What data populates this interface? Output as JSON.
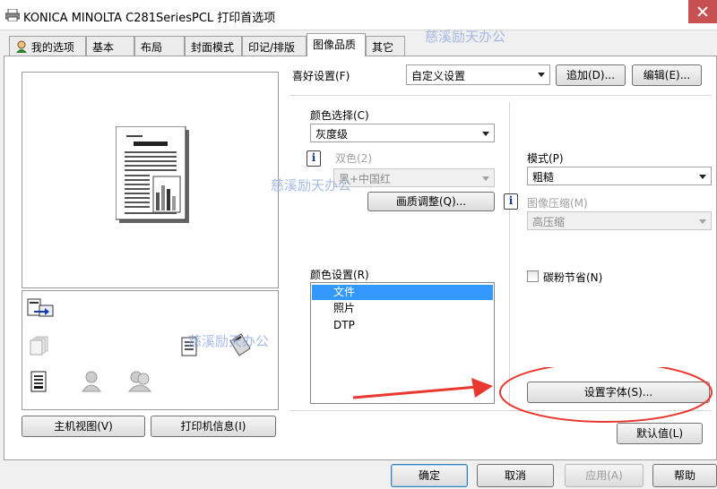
{
  "window": {
    "title": "KONICA MINOLTA C281SeriesPCL 打印首选项"
  },
  "tabs": [
    {
      "label": "我的选项"
    },
    {
      "label": "基本"
    },
    {
      "label": "布局"
    },
    {
      "label": "封面模式"
    },
    {
      "label": "印记/排版"
    },
    {
      "label": "图像品质"
    },
    {
      "label": "其它"
    }
  ],
  "active_tab": "图像品质",
  "favorites": {
    "label": "喜好设置(F)",
    "value": "自定义设置",
    "add_label": "追加(D)...",
    "edit_label": "编辑(E)..."
  },
  "color_select": {
    "label": "颜色选择(C)",
    "value": "灰度级"
  },
  "dual_color": {
    "label": "双色(2)",
    "value": "黑+中国红"
  },
  "quality_adjust_label": "画质调整(Q)...",
  "color_settings": {
    "label": "颜色设置(R)",
    "items": [
      "文件",
      "照片",
      "DTP"
    ],
    "selected": "文件"
  },
  "mode": {
    "label": "模式(P)",
    "value": "粗糙"
  },
  "image_compression": {
    "label": "图像压缩(M)",
    "value": "高压缩"
  },
  "toner_save": {
    "label": "碳粉节省(N)",
    "checked": false
  },
  "set_font_label": "设置字体(S)...",
  "default_label": "默认值(L)",
  "preview_buttons": {
    "main_view": "主机视图(V)",
    "printer_info": "打印机信息(I)"
  },
  "bottom_buttons": {
    "ok": "确定",
    "cancel": "取消",
    "apply": "应用(A)",
    "help": "帮助"
  },
  "watermark": {
    "text": "慈溪励天办公"
  },
  "annotation": {
    "arrow_color": "#e8382f",
    "ellipse_color": "#e8382f"
  },
  "colors": {
    "selection": "#3399ff",
    "window_bg": "#f0f0f0"
  }
}
